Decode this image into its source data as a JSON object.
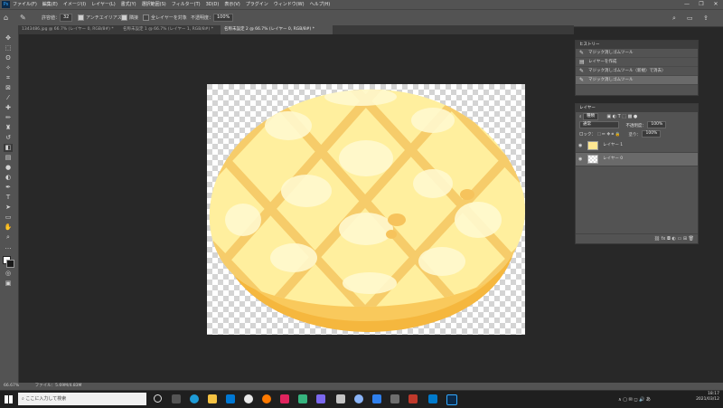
{
  "app": {
    "logo": "Ps"
  },
  "menu": [
    "ファイル(F)",
    "編集(E)",
    "イメージ(I)",
    "レイヤー(L)",
    "書式(Y)",
    "選択範囲(S)",
    "フィルター(T)",
    "3D(D)",
    "表示(V)",
    "プラグイン",
    "ウィンドウ(W)",
    "ヘルプ(H)"
  ],
  "window_controls": {
    "minimize": "—",
    "maximize": "❐",
    "close": "✕"
  },
  "options": {
    "tolerance_label": "許容値：",
    "tolerance_value": "32",
    "antialias_label": "アンチエイリアス",
    "contiguous_label": "隣接",
    "all_layers_label": "全レイヤーを対象",
    "opacity_label": "不透明度：",
    "opacity_value": "100%"
  },
  "tabs": [
    "1343486.jpg @ 66.7% (レイヤー 0, RGB/8#) *",
    "名称未設定 1 @ 66.7% (レイヤー 1, RGB/8#) *",
    "名称未設定 2 @ 66.7% (レイヤー 0, RGB/8#) *"
  ],
  "history": {
    "title": "ヒストリー",
    "items": [
      "マジック消しゴムツール",
      "レイヤーを作成",
      "マジック消しゴムツール（新規）で消去）",
      "マジック消しゴムツール"
    ]
  },
  "layers": {
    "title": "レイヤー",
    "kind_label": "種類",
    "blend_mode": "通常",
    "opacity_label": "不透明度：",
    "opacity_value": "100%",
    "lock_label": "ロック：",
    "fill_label": "塗り：",
    "fill_value": "100%",
    "items": [
      {
        "name": "レイヤー 1",
        "visible": true
      },
      {
        "name": "レイヤー 0",
        "visible": true
      }
    ]
  },
  "status": {
    "zoom": "66.67%",
    "doc": "ファイル：5.69M/4.83M"
  },
  "taskbar": {
    "search_placeholder": "ここに入力して検索",
    "time": "18:17",
    "date": "2021/03/12"
  },
  "colors": {
    "ui_dark": "#282828",
    "panel": "#535353",
    "accent_ps": "#31a8ff",
    "bun_light": "#fff3a8",
    "bun_dark": "#f5c86a"
  }
}
